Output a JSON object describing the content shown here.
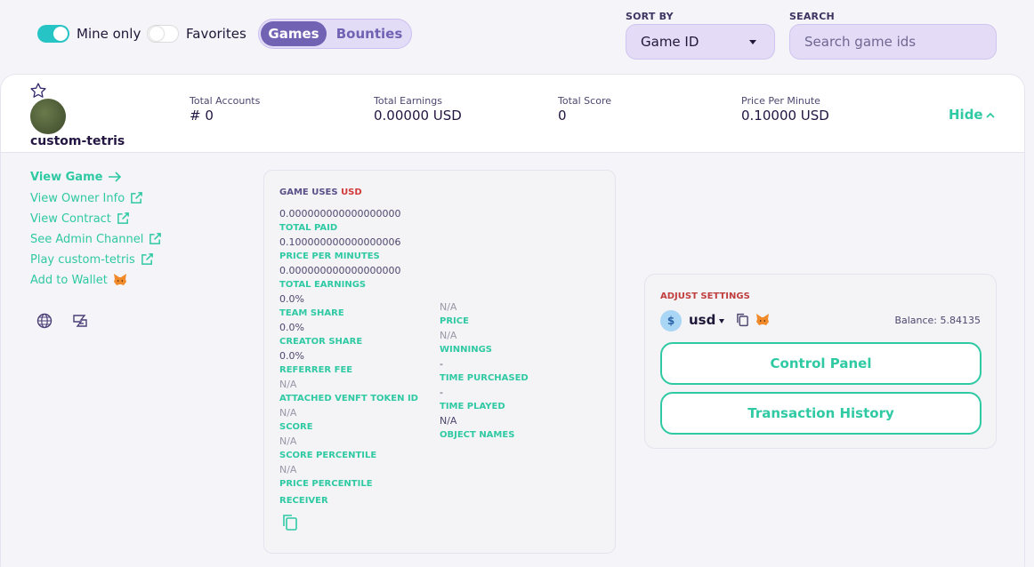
{
  "filters": {
    "mine_only": {
      "label": "Mine only",
      "on": true
    },
    "favorites": {
      "label": "Favorites",
      "on": false
    },
    "view_tabs": [
      {
        "label": "Games",
        "active": true
      },
      {
        "label": "Bounties",
        "active": false
      }
    ],
    "sort_by": {
      "label": "SORT BY",
      "value": "Game ID"
    },
    "search": {
      "label": "SEARCH",
      "placeholder": "Search game ids",
      "value": ""
    }
  },
  "game": {
    "name": "custom-tetris",
    "stats": [
      {
        "label": "Total Accounts",
        "value": "# 0"
      },
      {
        "label": "Total Earnings",
        "value": "0.00000 USD"
      },
      {
        "label": "Total Score",
        "value": "0"
      },
      {
        "label": "Price Per Minute",
        "value": "0.10000 USD"
      }
    ],
    "hide_label": "Hide"
  },
  "links": [
    {
      "label": "View Game",
      "icon": "arrow-right-icon"
    },
    {
      "label": "View Owner Info",
      "icon": "external-link-icon"
    },
    {
      "label": "View Contract",
      "icon": "external-link-icon"
    },
    {
      "label": "See Admin Channel",
      "icon": "external-link-icon"
    },
    {
      "label": "Play custom-tetris",
      "icon": "external-link-icon"
    },
    {
      "label": "Add to Wallet",
      "icon": "metamask-fox-icon"
    }
  ],
  "info": {
    "heading": "GAME USES",
    "currency": "USD",
    "left": [
      {
        "value": "0.000000000000000000",
        "label": "TOTAL PAID"
      },
      {
        "value": "0.100000000000000006",
        "label": "PRICE PER MINUTES"
      },
      {
        "value": "0.000000000000000000",
        "label": "TOTAL EARNINGS"
      },
      {
        "value": "0.0%",
        "label": "TEAM SHARE"
      },
      {
        "value": "0.0%",
        "label": "CREATOR SHARE"
      },
      {
        "value": "0.0%",
        "label": "REFERRER FEE"
      },
      {
        "value": "N/A",
        "label": "ATTACHED VENFT TOKEN ID"
      },
      {
        "value": "N/A",
        "label": "SCORE"
      },
      {
        "value": "N/A",
        "label": "SCORE PERCENTILE"
      },
      {
        "value": "N/A",
        "label": "PRICE PERCENTILE"
      },
      {
        "value": "",
        "label": "RECEIVER"
      }
    ],
    "right": [
      {
        "value": "N/A",
        "label": "PRICE"
      },
      {
        "value": "N/A",
        "label": "WINNINGS"
      },
      {
        "value": "-",
        "label": "TIME PURCHASED"
      },
      {
        "value": "-",
        "label": "TIME PLAYED"
      },
      {
        "value": "N/A",
        "label": "OBJECT NAMES"
      }
    ]
  },
  "settings": {
    "heading": "ADJUST SETTINGS",
    "coin_symbol": "$",
    "currency": "usd",
    "balance": "Balance: 5.84135",
    "buttons": [
      "Control Panel",
      "Transaction History"
    ]
  },
  "colors": {
    "accent": "#2fc9a3",
    "toggle_on": "#26c4c4",
    "tab_active": "#7262b3",
    "usd_red": "#d23a3a"
  }
}
